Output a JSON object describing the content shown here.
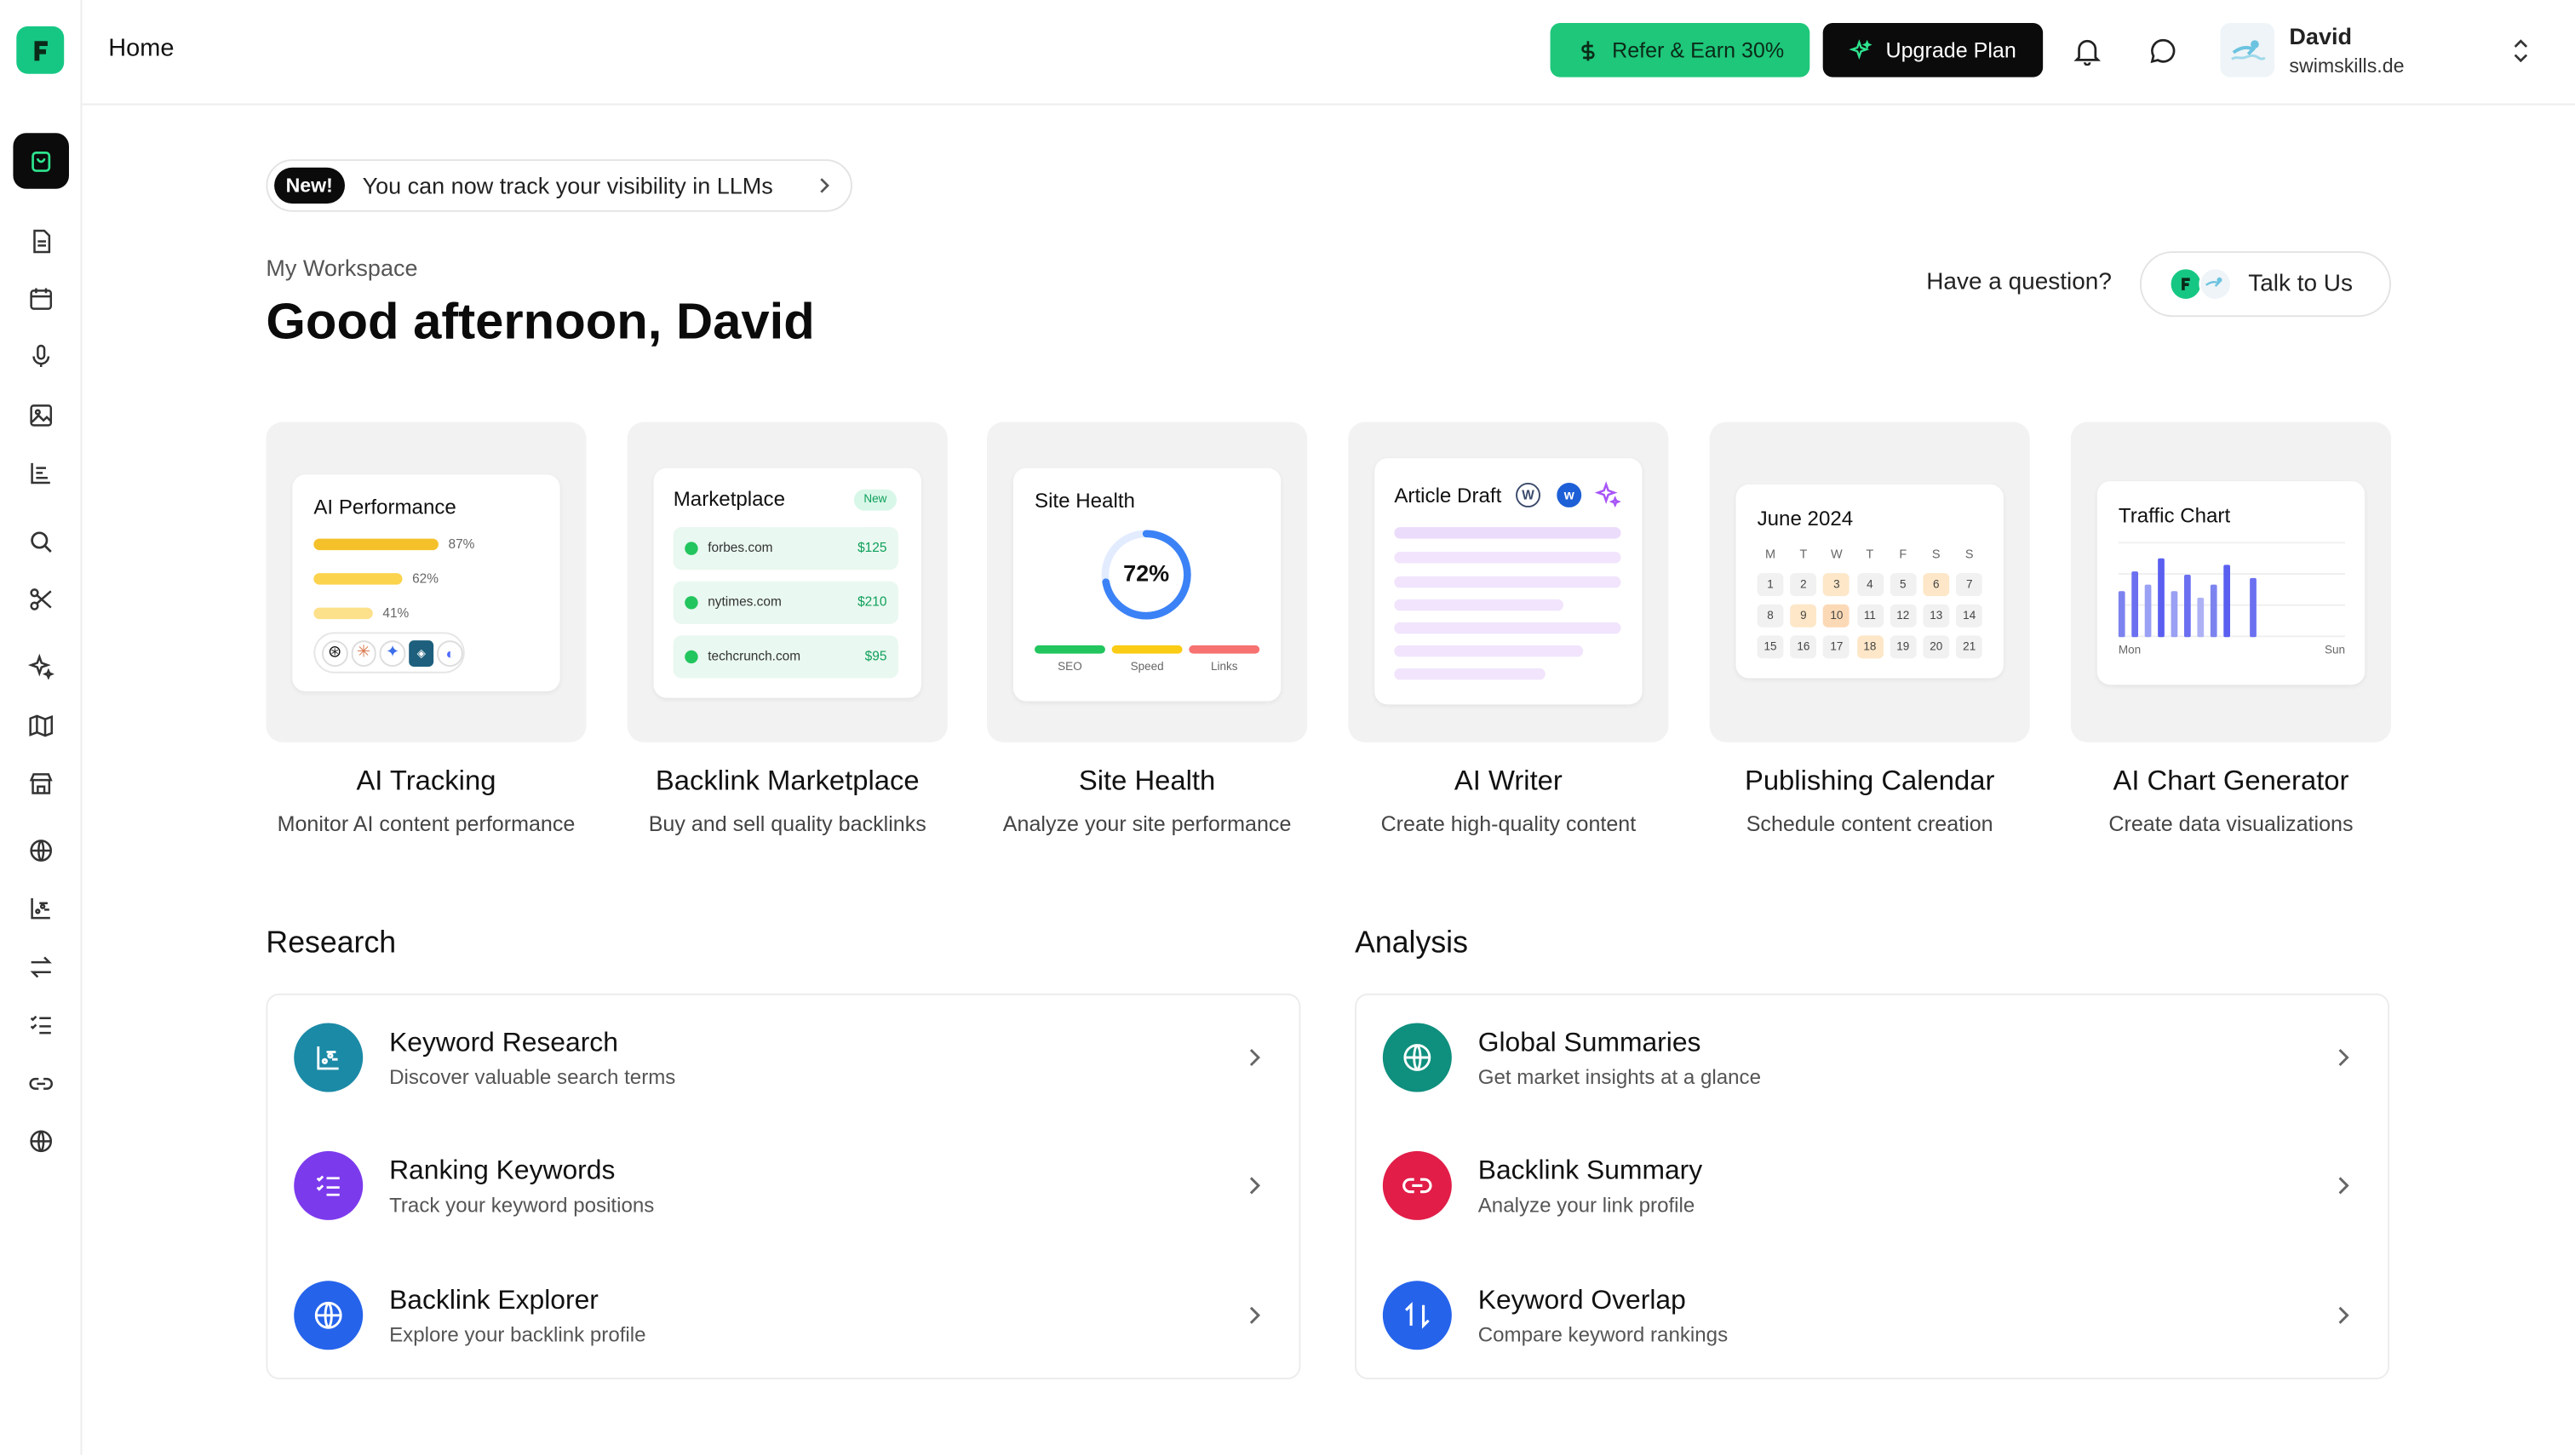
{
  "header": {
    "title": "Home",
    "refer_label": "Refer & Earn 30%",
    "upgrade_label": "Upgrade Plan",
    "user_name": "David",
    "user_site": "swimskills.de"
  },
  "announcement": {
    "badge": "New!",
    "text": "You can now track your visibility in LLMs"
  },
  "workspace": {
    "label": "My Workspace",
    "greeting": "Good afternoon, David",
    "question": "Have a question?",
    "talk_label": "Talk to Us"
  },
  "cards": [
    {
      "title": "AI Tracking",
      "subtitle": "Monitor AI content performance",
      "preview": {
        "heading": "AI Performance",
        "bars": [
          {
            "pct": "87%",
            "value": 0.87
          },
          {
            "pct": "62%",
            "value": 0.62
          },
          {
            "pct": "41%",
            "value": 0.41
          }
        ]
      }
    },
    {
      "title": "Backlink Marketplace",
      "subtitle": "Buy and sell quality backlinks",
      "preview": {
        "heading": "Marketplace",
        "badge": "New",
        "items": [
          {
            "site": "forbes.com",
            "price": "$125"
          },
          {
            "site": "nytimes.com",
            "price": "$210"
          },
          {
            "site": "techcrunch.com",
            "price": "$95"
          }
        ]
      }
    },
    {
      "title": "Site Health",
      "subtitle": "Analyze your site performance",
      "preview": {
        "heading": "Site Health",
        "score": "72%",
        "score_value": 0.72,
        "metrics": [
          "SEO",
          "Speed",
          "Links"
        ]
      }
    },
    {
      "title": "AI Writer",
      "subtitle": "Create high-quality content",
      "preview": {
        "heading": "Article Draft"
      }
    },
    {
      "title": "Publishing Calendar",
      "subtitle": "Schedule content creation",
      "preview": {
        "heading": "June 2024",
        "weekdays": [
          "M",
          "T",
          "W",
          "T",
          "F",
          "S",
          "S"
        ],
        "days": [
          "1",
          "2",
          "3",
          "4",
          "5",
          "6",
          "7",
          "8",
          "9",
          "10",
          "11",
          "12",
          "13",
          "14",
          "15",
          "16",
          "17",
          "18",
          "19",
          "20",
          "21"
        ]
      }
    },
    {
      "title": "AI Chart Generator",
      "subtitle": "Create data visualizations",
      "preview": {
        "heading": "Traffic Chart",
        "start_label": "Mon",
        "end_label": "Sun"
      }
    }
  ],
  "research": {
    "title": "Research",
    "items": [
      {
        "title": "Keyword Research",
        "subtitle": "Discover valuable search terms"
      },
      {
        "title": "Ranking Keywords",
        "subtitle": "Track your keyword positions"
      },
      {
        "title": "Backlink Explorer",
        "subtitle": "Explore your backlink profile"
      }
    ]
  },
  "analysis": {
    "title": "Analysis",
    "items": [
      {
        "title": "Global Summaries",
        "subtitle": "Get market insights at a glance"
      },
      {
        "title": "Backlink Summary",
        "subtitle": "Analyze your link profile"
      },
      {
        "title": "Keyword Overlap",
        "subtitle": "Compare keyword rankings"
      }
    ]
  },
  "icons": {
    "sidebar": [
      "shopping-bag-icon",
      "document-icon",
      "calendar-icon",
      "microphone-icon",
      "image-icon",
      "chart-list-icon",
      "search-icon",
      "scissors-icon",
      "sparkles-icon",
      "map-icon",
      "store-icon",
      "globe-icon",
      "chart-icon",
      "arrows-icon",
      "checklist-icon",
      "link-icon",
      "globe-icon"
    ]
  },
  "colors": {
    "brand": "#16c784",
    "refer_bg": "#1ec77a",
    "keyword_research": "#1b8aa6",
    "ranking_keywords": "#7c3aed",
    "backlink_explorer": "#2563eb",
    "global_summaries": "#0f8f7e",
    "backlink_summary": "#e11d48",
    "keyword_overlap": "#2563eb"
  }
}
